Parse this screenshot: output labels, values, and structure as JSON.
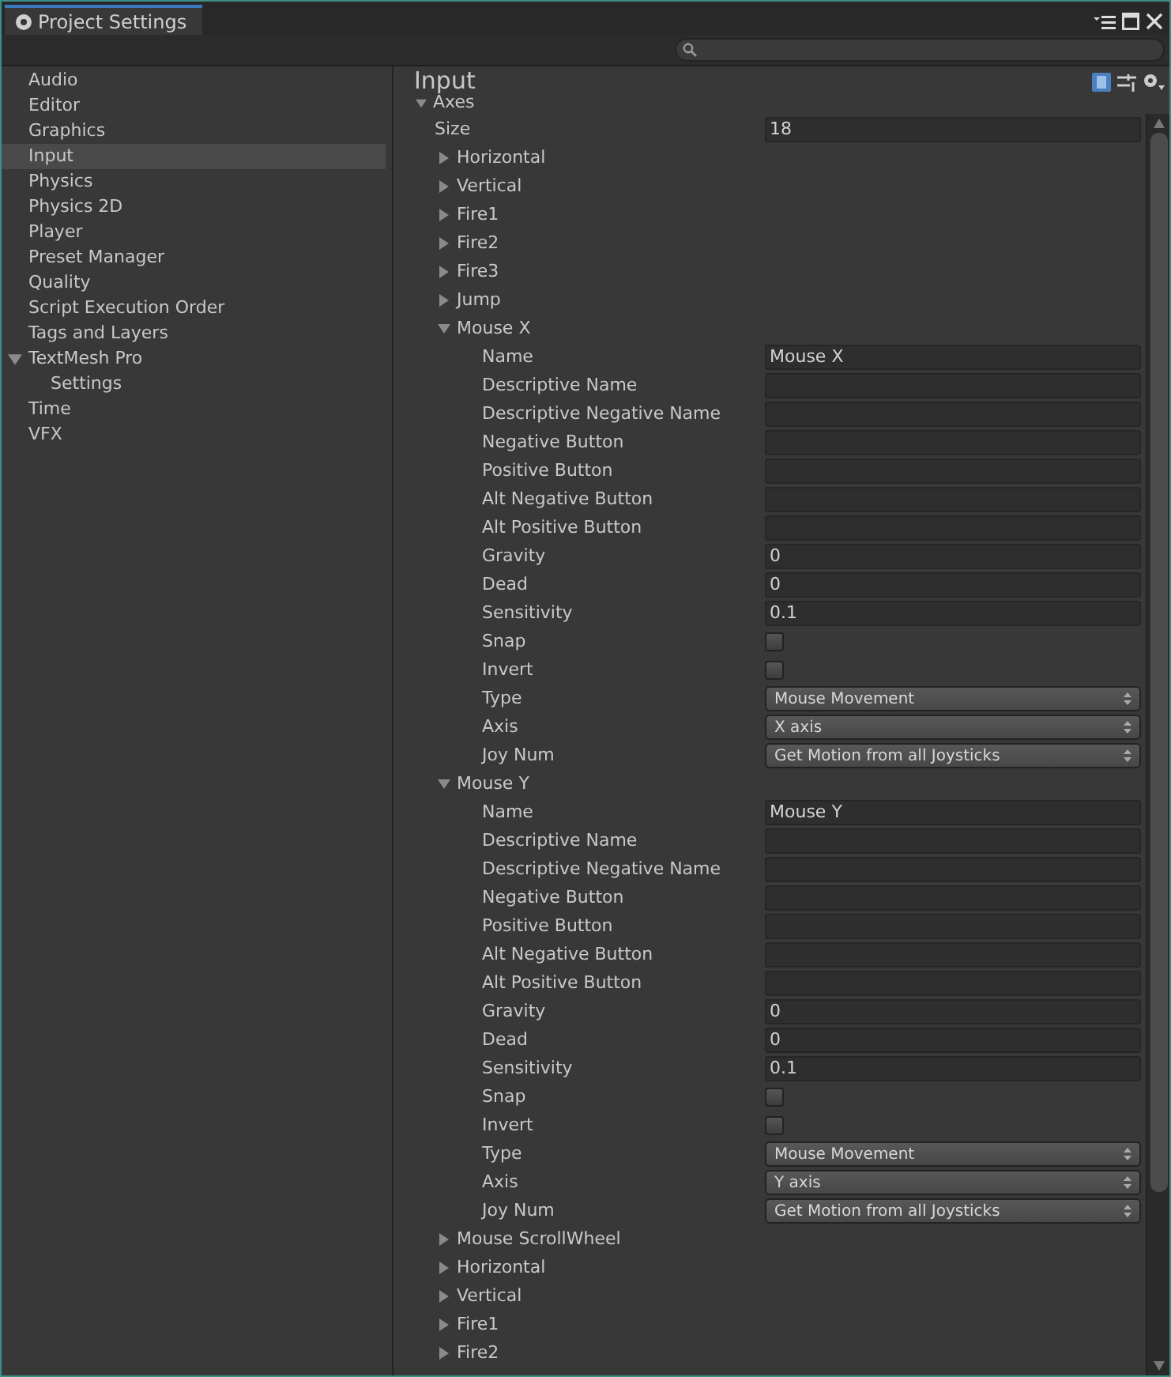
{
  "window": {
    "title": "Project Settings"
  },
  "sidebar": {
    "items": [
      {
        "label": "Audio",
        "selected": false
      },
      {
        "label": "Editor",
        "selected": false
      },
      {
        "label": "Graphics",
        "selected": false
      },
      {
        "label": "Input",
        "selected": true
      },
      {
        "label": "Physics",
        "selected": false
      },
      {
        "label": "Physics 2D",
        "selected": false
      },
      {
        "label": "Player",
        "selected": false
      },
      {
        "label": "Preset Manager",
        "selected": false
      },
      {
        "label": "Quality",
        "selected": false
      },
      {
        "label": "Script Execution Order",
        "selected": false
      },
      {
        "label": "Tags and Layers",
        "selected": false
      },
      {
        "label": "TextMesh Pro",
        "selected": false,
        "expanded": true,
        "children": [
          {
            "label": "Settings",
            "selected": false
          }
        ]
      },
      {
        "label": "Time",
        "selected": false
      },
      {
        "label": "VFX",
        "selected": false
      }
    ]
  },
  "panel": {
    "title": "Input",
    "section": {
      "label": "Axes",
      "expanded": true
    },
    "size": {
      "label": "Size",
      "value": "18"
    },
    "axes": [
      {
        "name": "Horizontal",
        "expanded": false
      },
      {
        "name": "Vertical",
        "expanded": false
      },
      {
        "name": "Fire1",
        "expanded": false
      },
      {
        "name": "Fire2",
        "expanded": false
      },
      {
        "name": "Fire3",
        "expanded": false
      },
      {
        "name": "Jump",
        "expanded": false
      },
      {
        "name": "Mouse X",
        "expanded": true,
        "fields": [
          {
            "kind": "text",
            "label": "Name",
            "value": "Mouse X"
          },
          {
            "kind": "text",
            "label": "Descriptive Name"
          },
          {
            "kind": "text",
            "label": "Descriptive Negative Name"
          },
          {
            "kind": "text",
            "label": "Negative Button"
          },
          {
            "kind": "text",
            "label": "Positive Button"
          },
          {
            "kind": "text",
            "label": "Alt Negative Button"
          },
          {
            "kind": "text",
            "label": "Alt Positive Button"
          },
          {
            "kind": "text",
            "label": "Gravity",
            "value": "0"
          },
          {
            "kind": "text",
            "label": "Dead",
            "value": "0"
          },
          {
            "kind": "text",
            "label": "Sensitivity",
            "value": "0.1"
          },
          {
            "kind": "checkbox",
            "label": "Snap",
            "checked": false
          },
          {
            "kind": "checkbox",
            "label": "Invert",
            "checked": false
          },
          {
            "kind": "dropdown",
            "label": "Type",
            "value": "Mouse Movement"
          },
          {
            "kind": "dropdown",
            "label": "Axis",
            "value": "X axis"
          },
          {
            "kind": "dropdown",
            "label": "Joy Num",
            "value": "Get Motion from all Joysticks"
          }
        ]
      },
      {
        "name": "Mouse Y",
        "expanded": true,
        "fields": [
          {
            "kind": "text",
            "label": "Name",
            "value": "Mouse Y"
          },
          {
            "kind": "text",
            "label": "Descriptive Name"
          },
          {
            "kind": "text",
            "label": "Descriptive Negative Name"
          },
          {
            "kind": "text",
            "label": "Negative Button"
          },
          {
            "kind": "text",
            "label": "Positive Button"
          },
          {
            "kind": "text",
            "label": "Alt Negative Button"
          },
          {
            "kind": "text",
            "label": "Alt Positive Button"
          },
          {
            "kind": "text",
            "label": "Gravity",
            "value": "0"
          },
          {
            "kind": "text",
            "label": "Dead",
            "value": "0"
          },
          {
            "kind": "text",
            "label": "Sensitivity",
            "value": "0.1"
          },
          {
            "kind": "checkbox",
            "label": "Snap",
            "checked": false
          },
          {
            "kind": "checkbox",
            "label": "Invert",
            "checked": false
          },
          {
            "kind": "dropdown",
            "label": "Type",
            "value": "Mouse Movement"
          },
          {
            "kind": "dropdown",
            "label": "Axis",
            "value": "Y axis"
          },
          {
            "kind": "dropdown",
            "label": "Joy Num",
            "value": "Get Motion from all Joysticks"
          }
        ]
      },
      {
        "name": "Mouse ScrollWheel",
        "expanded": false
      },
      {
        "name": "Horizontal",
        "expanded": false
      },
      {
        "name": "Vertical",
        "expanded": false
      },
      {
        "name": "Fire1",
        "expanded": false
      },
      {
        "name": "Fire2",
        "expanded": false
      }
    ]
  }
}
